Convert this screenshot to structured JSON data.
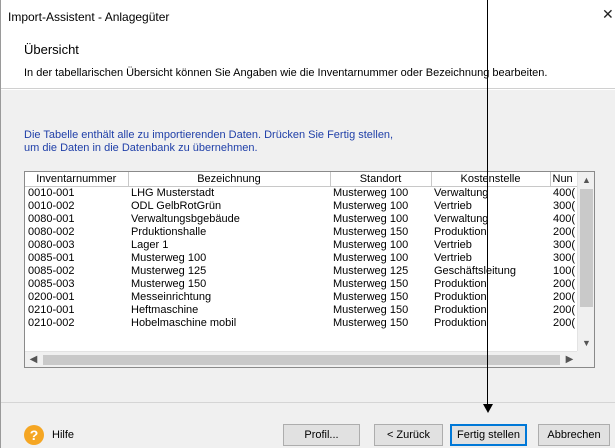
{
  "window": {
    "title": "Import-Assistent - Anlagegüter",
    "close_glyph": "✕"
  },
  "header": {
    "title": "Übersicht",
    "description": "In der tabellarischen Übersicht können Sie Angaben wie die Inventarnummer oder Bezeichnung bearbeiten."
  },
  "info": {
    "line1": "Die Tabelle enthält alle zu importierenden Daten. Drücken Sie Fertig stellen,",
    "line2": "um die Daten in die Datenbank zu übernehmen."
  },
  "table": {
    "columns": [
      "Inventarnummer",
      "Bezeichnung",
      "Standort",
      "Kostenstelle",
      "Nun"
    ],
    "rows": [
      [
        "0010-001",
        "LHG Musterstadt",
        "Musterweg 100",
        "Verwaltung",
        "400("
      ],
      [
        "0010-002",
        "ODL GelbRotGrün",
        "Musterweg 100",
        "Vertrieb",
        "300("
      ],
      [
        "0080-001",
        "Verwaltungsbgebäude",
        "Musterweg 100",
        "Verwaltung",
        "400("
      ],
      [
        "0080-002",
        "Prduktionshalle",
        "Musterweg 150",
        "Produktion",
        "200("
      ],
      [
        "0080-003",
        "Lager 1",
        "Musterweg 100",
        "Vertrieb",
        "300("
      ],
      [
        "0085-001",
        "Musterweg 100",
        "Musterweg 100",
        "Vertrieb",
        "300("
      ],
      [
        "0085-002",
        "Musterweg 125",
        "Musterweg 125",
        "Geschäftsleitung",
        "100("
      ],
      [
        "0085-003",
        "Musterweg 150",
        "Musterweg 150",
        "Produktion",
        "200("
      ],
      [
        "0200-001",
        "Messeinrichtung",
        "Musterweg 150",
        "Produktion",
        "200("
      ],
      [
        "0210-001",
        "Heftmaschine",
        "Musterweg 150",
        "Produktion",
        "200("
      ],
      [
        "0210-002",
        "Hobelmaschine mobil",
        "Musterweg 150",
        "Produktion",
        "200("
      ]
    ]
  },
  "footer": {
    "help_label": "Hilfe",
    "help_glyph": "?",
    "buttons": {
      "profil": "Profil...",
      "back": "< Zurück",
      "finish": "Fertig stellen",
      "cancel": "Abbrechen"
    }
  },
  "colors": {
    "info_text": "#1f3fa8",
    "help_icon": "#f5a623",
    "focus_border": "#0078d7"
  }
}
